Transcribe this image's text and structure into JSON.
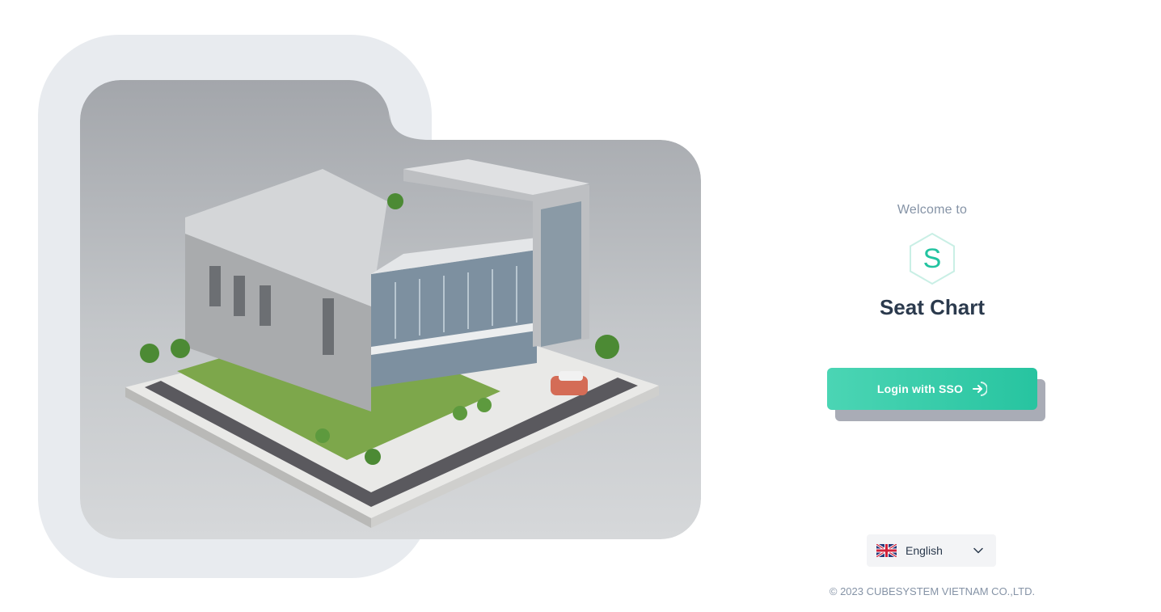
{
  "hero": {
    "image_label": "office-building-illustration"
  },
  "welcome": {
    "prefix": "Welcome to",
    "logo_letter": "S",
    "app_name": "Seat Chart"
  },
  "login": {
    "sso_label": "Login with SSO",
    "icon": "arrow-right-circle-icon"
  },
  "language": {
    "selected": "English",
    "flag": "uk-flag-icon",
    "chevron": "chevron-down-icon"
  },
  "footer": {
    "copyright": "© 2023 CUBESYSTEM VIETNAM CO.,LTD."
  },
  "colors": {
    "accent": "#27c4a0",
    "text_dark": "#2b3a4d",
    "text_muted": "#8593a6",
    "backdrop": "#e8ebef"
  }
}
